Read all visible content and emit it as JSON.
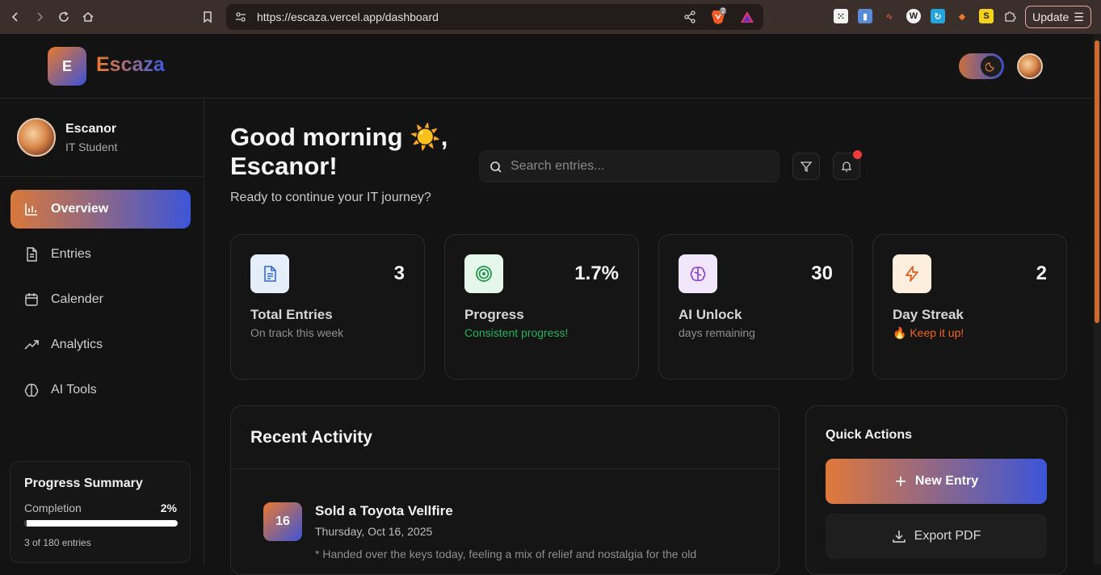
{
  "browser": {
    "url": "https://escaza.vercel.app/dashboard",
    "shields_count": "2",
    "update_label": "Update"
  },
  "app": {
    "logo_letter": "E",
    "name": "Escaza"
  },
  "user": {
    "name": "Escanor",
    "role": "IT Student"
  },
  "sidebar": {
    "items": [
      {
        "label": "Overview",
        "icon": "bar-chart-icon",
        "active": true
      },
      {
        "label": "Entries",
        "icon": "document-icon"
      },
      {
        "label": "Calender",
        "icon": "calendar-icon"
      },
      {
        "label": "Analytics",
        "icon": "trending-icon"
      },
      {
        "label": "AI Tools",
        "icon": "brain-icon"
      }
    ],
    "summary": {
      "title": "Progress Summary",
      "label": "Completion",
      "percent": "2%",
      "fraction": 0.017,
      "sub": "3 of 180 entries"
    }
  },
  "greeting": {
    "title": "Good morning ☀️, Escanor!",
    "subtitle": "Ready to continue your IT journey?"
  },
  "search": {
    "placeholder": "Search entries..."
  },
  "stats": [
    {
      "value": "3",
      "label": "Total Entries",
      "sub": "On track this week",
      "icon": "document-icon",
      "color": "#2f6bd8",
      "bg": "#e6eefc",
      "sub_color": "#8f8f8f"
    },
    {
      "value": "1.7%",
      "label": "Progress",
      "sub": "Consistent progress!",
      "icon": "target-icon",
      "color": "#1f9a4a",
      "bg": "#e4f7ea",
      "sub_color": "#22b35a"
    },
    {
      "value": "30",
      "label": "AI Unlock",
      "sub": "days remaining",
      "icon": "brain-icon",
      "color": "#8a3ad8",
      "bg": "#f1e6fb",
      "sub_color": "#8f8f8f"
    },
    {
      "value": "2",
      "label": "Day Streak",
      "sub": "🔥 Keep it up!",
      "icon": "lightning-icon",
      "color": "#e25a1c",
      "bg": "#fdeede",
      "sub_color": "#f0641e"
    }
  ],
  "activity": {
    "title": "Recent Activity",
    "items": [
      {
        "day": "16",
        "title": "Sold a Toyota Vellfire",
        "date": "Thursday, Oct 16, 2025",
        "desc": "* Handed over the keys today, feeling a mix of relief and nostalgia for the old"
      }
    ]
  },
  "quick_actions": {
    "title": "Quick Actions",
    "new_entry": "New Entry",
    "export_pdf": "Export PDF"
  }
}
